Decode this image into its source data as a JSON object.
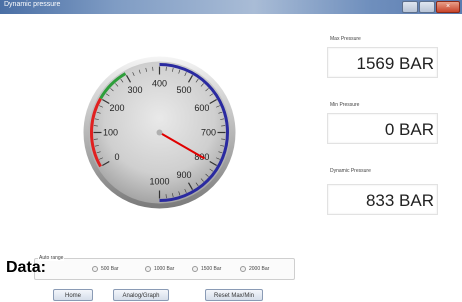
{
  "window": {
    "title": "Dynamic pressure",
    "close_glyph": "×"
  },
  "gauge": {
    "min": 0,
    "max": 1000,
    "needle_value": 800,
    "tick_labels": [
      "0",
      "100",
      "200",
      "300",
      "400",
      "500",
      "600",
      "700",
      "800",
      "900",
      "1000"
    ],
    "arc_colors": {
      "low": "#e02020",
      "mid": "#2e9e3a",
      "high": "#2a2aa0"
    },
    "needle_color": "#e00000"
  },
  "panels": {
    "max": {
      "label": "Max Pressure",
      "value": "1569 BAR"
    },
    "min": {
      "label": "Min Pressure",
      "value": "0 BAR"
    },
    "dynamic": {
      "label": "Dynamic Pressure",
      "value": "833 BAR"
    }
  },
  "autorange": {
    "label": "Auto range",
    "options": [
      "500 Bar",
      "1000 Bar",
      "1500 Bar",
      "2000 Bar"
    ]
  },
  "data_label": "Data:",
  "nav": {
    "home": "Home",
    "analog_graph": "Analog/Graph",
    "reset": "Reset Max/Min"
  }
}
